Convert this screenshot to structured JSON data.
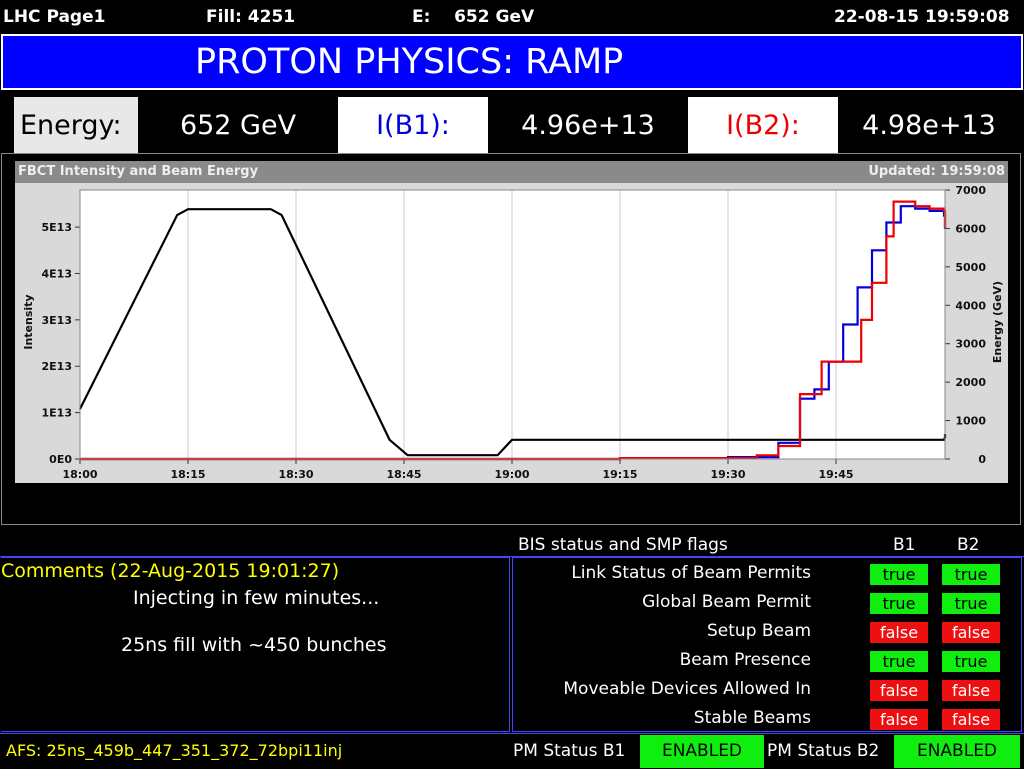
{
  "header": {
    "page": "LHC Page1",
    "fill": "Fill: 4251",
    "energy": "E:    652 GeV",
    "datetime": "22-08-15 19:59:08"
  },
  "title": "PROTON PHYSICS: RAMP",
  "readouts": {
    "energy_label": "Energy:",
    "energy_value": "652 GeV",
    "ib1_label": "I(B1):",
    "ib1_value": "4.96e+13",
    "ib2_label": "I(B2):",
    "ib2_value": "4.98e+13"
  },
  "colors": {
    "title_bg": "#0000ff",
    "b1": "#0000dd",
    "b2": "#ee0000",
    "energy": "#000000",
    "true": "#10ee10",
    "false": "#ee1010",
    "comments_text": "#ffff00"
  },
  "chart_data": {
    "type": "line",
    "title": "FBCT Intensity and Beam Energy",
    "updated": "Updated: 19:59:08",
    "ylabel": "Intensity",
    "y2label": "Energy (GeV)",
    "ylim": [
      0,
      5.8
    ],
    "y2lim": [
      0,
      7000
    ],
    "xlim": [
      0,
      120
    ],
    "x_ticks": [
      0,
      15,
      30,
      45,
      60,
      75,
      90,
      105
    ],
    "x_tick_labels": [
      "18:00",
      "18:15",
      "18:30",
      "18:45",
      "19:00",
      "19:15",
      "19:30",
      "19:45"
    ],
    "y_ticks": [
      0,
      1,
      2,
      3,
      4,
      5
    ],
    "y_tick_labels": [
      "0E0",
      "1E13",
      "2E13",
      "3E13",
      "4E13",
      "5E13"
    ],
    "y2_ticks": [
      0,
      1000,
      2000,
      3000,
      4000,
      5000,
      6000,
      7000
    ],
    "y2_tick_labels": [
      "0",
      "1000",
      "2000",
      "3000",
      "4000",
      "5000",
      "6000",
      "7000"
    ],
    "series": [
      {
        "name": "Energy",
        "axis": "right",
        "color": "#000000",
        "step": false,
        "x": [
          0,
          13.5,
          15,
          26.5,
          28,
          43,
          45.5,
          58,
          60,
          120,
          121.5,
          123
        ],
        "y": [
          1300,
          6350,
          6500,
          6500,
          6350,
          500,
          100,
          100,
          500,
          500,
          560,
          650
        ]
      },
      {
        "name": "I(B1)",
        "axis": "left",
        "color": "#0000dd",
        "step": true,
        "x": [
          0,
          75,
          90,
          97,
          100,
          102,
          104,
          106,
          108,
          110,
          112,
          114,
          116,
          118,
          120,
          121,
          123
        ],
        "y": [
          0,
          0.02,
          0.04,
          0.35,
          1.3,
          1.5,
          2.1,
          2.9,
          3.7,
          4.5,
          5.1,
          5.45,
          5.4,
          5.35,
          5.25,
          5.05,
          4.96
        ]
      },
      {
        "name": "I(B2)",
        "axis": "left",
        "color": "#ee0000",
        "step": true,
        "x": [
          0,
          75,
          94,
          97,
          100,
          103,
          106,
          108.5,
          110,
          112,
          113,
          116,
          118,
          120,
          121,
          123
        ],
        "y": [
          0,
          0.02,
          0.08,
          0.28,
          1.4,
          2.1,
          2.1,
          3.0,
          3.8,
          4.8,
          5.55,
          5.45,
          5.4,
          5.35,
          5.2,
          4.98
        ]
      }
    ]
  },
  "comments": {
    "heading": "Comments (22-Aug-2015 19:01:27)",
    "line1": "Injecting in few minutes...",
    "line2": "25ns fill with ~450 bunches"
  },
  "flags": {
    "heading": "BIS status and SMP flags",
    "col_b1": "B1",
    "col_b2": "B2",
    "rows": [
      {
        "label": "Link Status of Beam Permits",
        "b1": "true",
        "b2": "true"
      },
      {
        "label": "Global Beam Permit",
        "b1": "true",
        "b2": "true"
      },
      {
        "label": "Setup Beam",
        "b1": "false",
        "b2": "false"
      },
      {
        "label": "Beam Presence",
        "b1": "true",
        "b2": "true"
      },
      {
        "label": "Moveable Devices Allowed In",
        "b1": "false",
        "b2": "false"
      },
      {
        "label": "Stable Beams",
        "b1": "false",
        "b2": "false"
      }
    ]
  },
  "footer": {
    "afs": "AFS: 25ns_459b_447_351_372_72bpi11inj",
    "pm_b1_label": "PM Status B1",
    "pm_b1_value": "ENABLED",
    "pm_b2_label": "PM Status B2",
    "pm_b2_value": "ENABLED"
  }
}
